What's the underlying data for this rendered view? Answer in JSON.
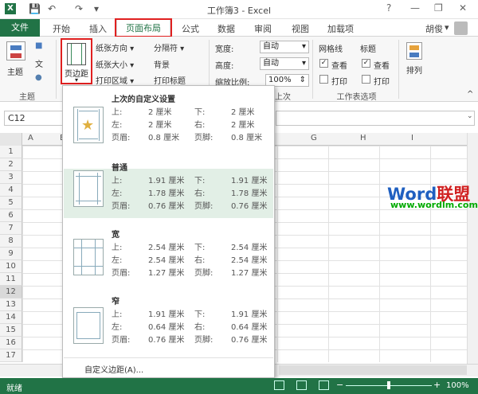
{
  "window": {
    "title": "工作簿3 - Excel",
    "help": "?",
    "minimize": "—",
    "restore": "❐",
    "close": "✕"
  },
  "qat": {
    "save": "💾",
    "undo": "↶",
    "redo": "↷",
    "more": "▾"
  },
  "tabs": [
    {
      "label": "文件"
    },
    {
      "label": "开始"
    },
    {
      "label": "插入"
    },
    {
      "label": "页面布局"
    },
    {
      "label": "公式"
    },
    {
      "label": "数据"
    },
    {
      "label": "审阅"
    },
    {
      "label": "视图"
    },
    {
      "label": "加载项"
    }
  ],
  "user": {
    "name": "胡俊",
    "menu": "▾"
  },
  "ribbon": {
    "themes": {
      "theme_label": "主题",
      "group": "主题",
      "colors_icon": "■",
      "fonts_icon": "文",
      "effects_icon": "●"
    },
    "page_setup": {
      "margins": "页边距",
      "orientation": "纸张方向 ▾",
      "breaks": "分隔符 ▾",
      "size": "纸张大小 ▾",
      "background": "背景",
      "print_area": "打印区域 ▾",
      "print_titles": "打印标题"
    },
    "scale": {
      "width_label": "宽度:",
      "width_value": "自动",
      "height_label": "高度:",
      "height_value": "自动",
      "scale_label": "缩放比例:",
      "scale_value": "100%",
      "group": "上次"
    },
    "sheet_options": {
      "gridlines": "网格线",
      "headings": "标题",
      "view1": "查看",
      "view2": "查看",
      "print1": "打印",
      "print2": "打印",
      "group": "工作表选项"
    },
    "arrange": {
      "label": "排列"
    }
  },
  "formula": {
    "namebox": "C12"
  },
  "columns": [
    "A",
    "B",
    "G",
    "H",
    "I"
  ],
  "rows": [
    "1",
    "2",
    "3",
    "4",
    "5",
    "6",
    "7",
    "8",
    "9",
    "10",
    "11",
    "12",
    "13",
    "14",
    "15",
    "16",
    "17"
  ],
  "margins_panel": {
    "presets": [
      {
        "name": "上次的自定义设置",
        "top_k": "上:",
        "top": "2 厘米",
        "bottom_k": "下:",
        "bottom": "2 厘米",
        "left_k": "左:",
        "left": "2 厘米",
        "right_k": "右:",
        "right": "2 厘米",
        "header_k": "页眉:",
        "header": "0.8 厘米",
        "footer_k": "页脚:",
        "footer": "0.8 厘米",
        "icon": "★"
      },
      {
        "name": "普通",
        "top_k": "上:",
        "top": "1.91 厘米",
        "bottom_k": "下:",
        "bottom": "1.91 厘米",
        "left_k": "左:",
        "left": "1.78 厘米",
        "right_k": "右:",
        "right": "1.78 厘米",
        "header_k": "页眉:",
        "header": "0.76 厘米",
        "footer_k": "页脚:",
        "footer": "0.76 厘米",
        "icon": ""
      },
      {
        "name": "宽",
        "top_k": "上:",
        "top": "2.54 厘米",
        "bottom_k": "下:",
        "bottom": "2.54 厘米",
        "left_k": "左:",
        "left": "2.54 厘米",
        "right_k": "右:",
        "right": "2.54 厘米",
        "header_k": "页眉:",
        "header": "1.27 厘米",
        "footer_k": "页脚:",
        "footer": "1.27 厘米",
        "icon": ""
      },
      {
        "name": "窄",
        "top_k": "上:",
        "top": "1.91 厘米",
        "bottom_k": "下:",
        "bottom": "1.91 厘米",
        "left_k": "左:",
        "left": "0.64 厘米",
        "right_k": "右:",
        "right": "0.64 厘米",
        "header_k": "页眉:",
        "header": "0.76 厘米",
        "footer_k": "页脚:",
        "footer": "0.76 厘米",
        "icon": ""
      }
    ],
    "custom": "自定义边距(A)..."
  },
  "watermark": {
    "word": "Word",
    "lianmeng": "联盟",
    "url": "www.wordlm.com"
  },
  "status": {
    "ready": "就绪",
    "zoom": "100%",
    "zoom_minus": "−",
    "zoom_plus": "+"
  },
  "colors": {
    "accent": "#217346",
    "highlight_border": "#e02020",
    "selected_bg": "#e2efe6"
  }
}
